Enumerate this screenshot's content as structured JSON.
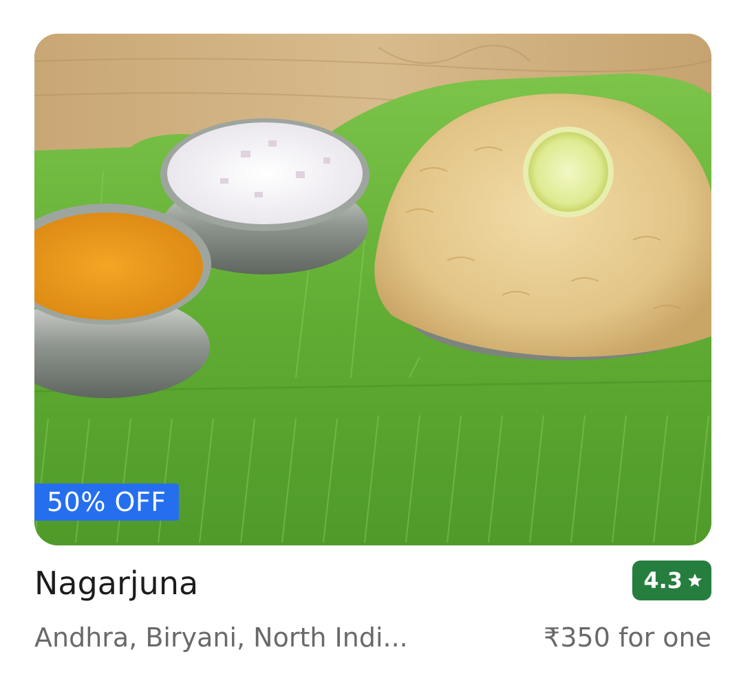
{
  "card": {
    "image_icon": "biryani-food-photo",
    "discount": "50% OFF",
    "name": "Nagarjuna",
    "rating": "4.3",
    "rating_icon": "star-icon",
    "cuisines": "Andhra, Biryani, North Indi...",
    "price": "₹350 for one"
  },
  "colors": {
    "discount_badge": "#256fef",
    "rating_badge": "#267e3e",
    "name_text": "#1c1c1c",
    "secondary_text": "#696969"
  }
}
